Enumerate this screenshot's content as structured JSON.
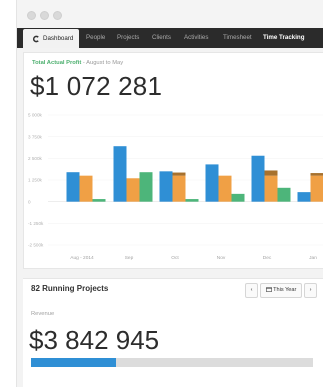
{
  "nav": {
    "items": [
      "Dashboard",
      "People",
      "Projects",
      "Clients",
      "Activities",
      "Timesheet",
      "Time Tracking"
    ],
    "active": "Dashboard"
  },
  "profit": {
    "label_strong": "Total Actual Profit",
    "label_rest": " - August to May",
    "value": "$1 072 281"
  },
  "chart_data": {
    "type": "bar",
    "categories": [
      "Aug - 2014",
      "Sep",
      "Oct",
      "Nov",
      "Dec",
      "Jan"
    ],
    "yticks": [
      "5 000k",
      "3 750k",
      "2 500k",
      "1 250k",
      "0",
      "-1 250k",
      "-2 500k"
    ],
    "ylim": [
      -2500,
      5000
    ],
    "colors": {
      "blue": "#2f8fd5",
      "orange": "#f0a045",
      "brown": "#a7712d",
      "green": "#4db57a",
      "red": "#e25a37"
    },
    "series": [
      {
        "values": [
          1700,
          3200,
          1750,
          2150,
          2650,
          550
        ]
      },
      {
        "values": [
          1500,
          1350,
          1500,
          1500,
          1500,
          1500
        ]
      },
      {
        "values": [
          150,
          1700,
          150,
          450,
          800,
          -800
        ]
      }
    ],
    "overlay": {
      "values": [
        0,
        0,
        180,
        0,
        300,
        150
      ]
    }
  },
  "projects": {
    "title": "82 Running Projects",
    "prev": "‹",
    "period": "This Year",
    "next": "›"
  },
  "revenue": {
    "label": "Revenue",
    "value": "$3 842 945",
    "progress": 0.3
  }
}
